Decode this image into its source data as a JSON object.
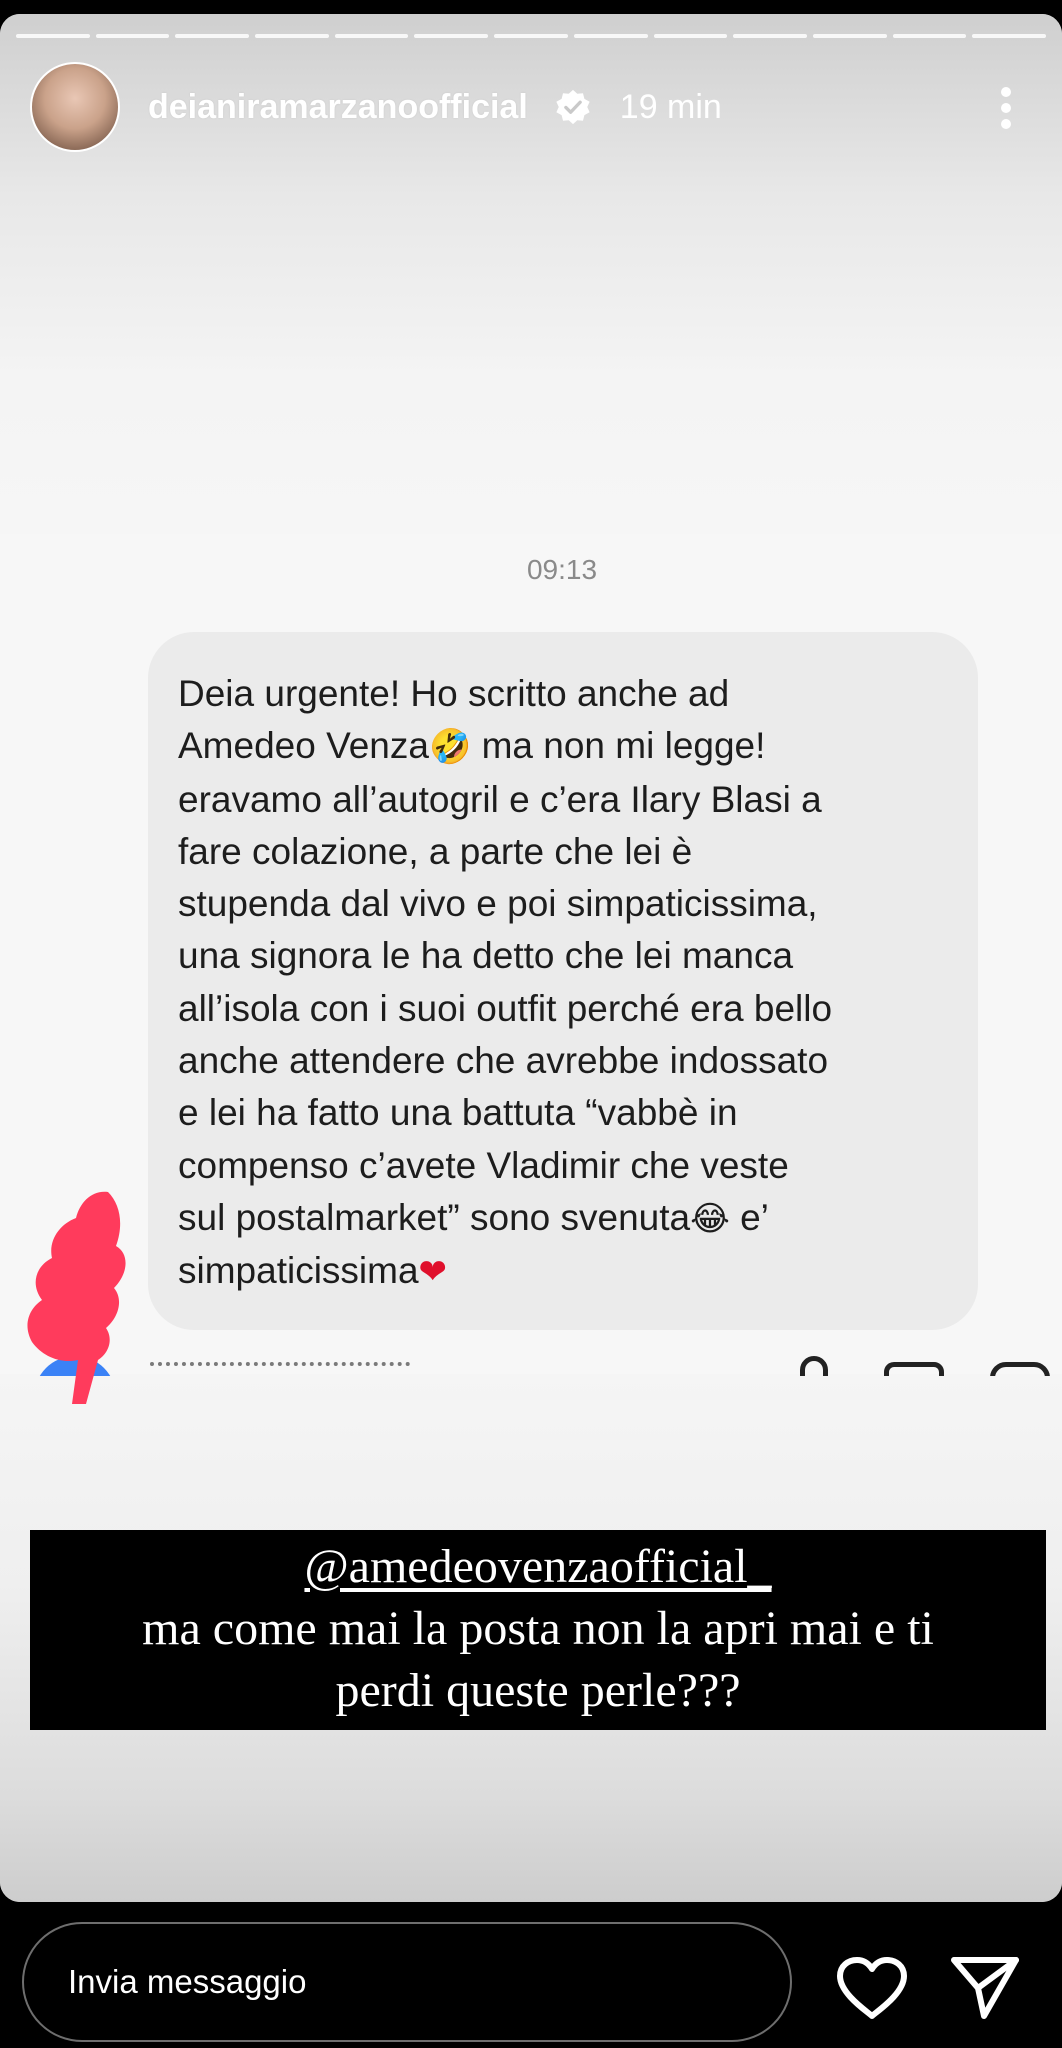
{
  "story": {
    "progress_segments": 13,
    "user": {
      "username": "deianiramarzanoofficial",
      "verified": true,
      "time_ago": "19 min"
    }
  },
  "dm": {
    "timestamp": "09:13",
    "message_lines": [
      "Deia urgente! Ho scritto anche ad",
      "Amedeo Venza",
      " ma non mi legge!",
      " eravamo all’autogril e c’era Ilary Blasi a",
      "fare colazione, a parte che lei è",
      "stupenda dal vivo e poi simpaticissima,",
      "una signora le ha detto che lei manca",
      "all’isola con i suoi outfit perché era bello",
      "anche attendere che avrebbe indossato",
      "e lei ha fatto una battuta “vabbè in",
      "compenso c’avete Vladimir che veste",
      "sul postalmarket” sono svenuta",
      " e’",
      "simpaticissima"
    ],
    "emojis": {
      "rofl": "🤣",
      "tears_of_joy": "😂",
      "heart": "❤"
    }
  },
  "caption": {
    "mention": "@amedeovenzaofficial_",
    "line2": "ma come mai la posta non la apri mai e ti",
    "line3": "perdi queste perle???"
  },
  "footer": {
    "message_placeholder": "Invia messaggio"
  },
  "colors": {
    "bubble": "#ebebeb",
    "scribble": "#ff3b5c",
    "caption_bg": "#000000"
  }
}
